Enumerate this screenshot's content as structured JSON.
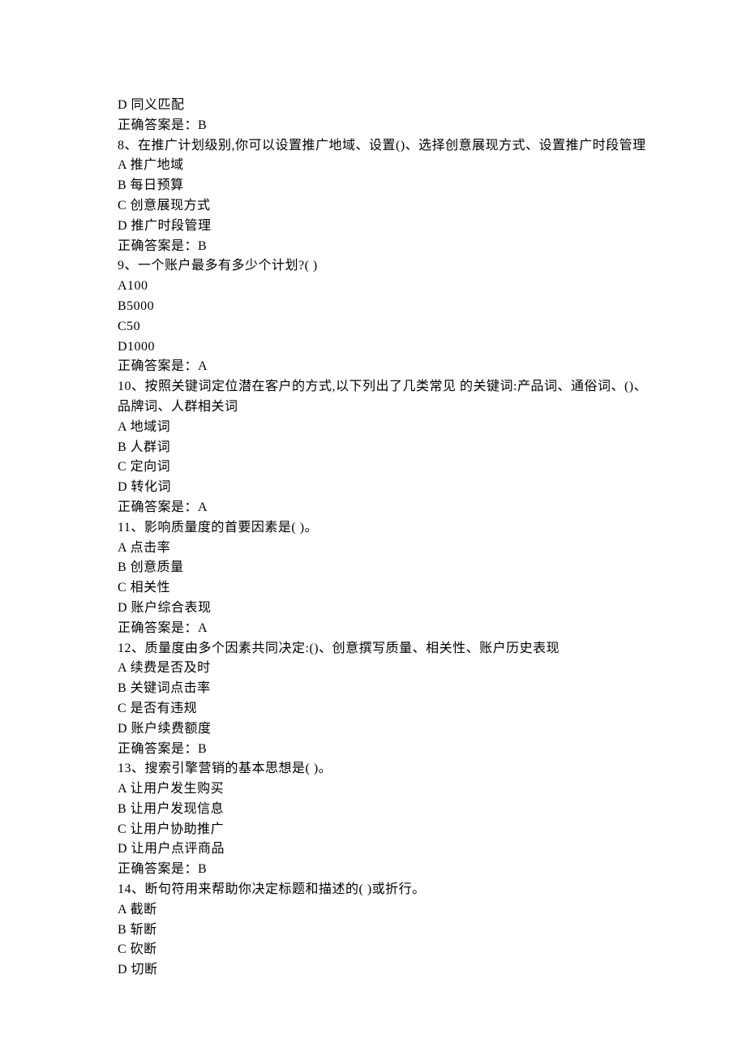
{
  "lines": [
    "D 同义匹配",
    "正确答案是：B",
    "8、在推广计划级别,你可以设置推广地域、设置()、选择创意展现方式、设置推广时段管理",
    "A 推广地域",
    "B 每日预算",
    "C 创意展现方式",
    "D 推广时段管理",
    "正确答案是：B",
    "9、一个账户最多有多少个计划?( )",
    "A100",
    "B5000",
    "C50",
    "D1000",
    "正确答案是：A",
    "10、按照关键词定位潜在客户的方式,以下列出了几类常见 的关键词:产品词、通俗词、()、品牌词、人群相关词",
    "A 地域词",
    "B 人群词",
    "C 定向词",
    "D 转化词",
    "正确答案是：A",
    "11、影响质量度的首要因素是( )。",
    "A 点击率",
    "B 创意质量",
    "C 相关性",
    "D 账户综合表现",
    "正确答案是：A",
    "12、质量度由多个因素共同决定:()、创意撰写质量、相关性、账户历史表现",
    "A 续费是否及时",
    "B 关键词点击率",
    "C 是否有违规",
    "D 账户续费额度",
    "正确答案是：B",
    "13、搜索引擎营销的基本思想是( )。",
    "A 让用户发生购买",
    "B 让用户发现信息",
    "C 让用户协助推广",
    "D 让用户点评商品",
    "正确答案是：B",
    "14、断句符用来帮助你决定标题和描述的( )或折行。",
    "A 截断",
    "B 斩断",
    "C 砍断",
    "D 切断"
  ]
}
